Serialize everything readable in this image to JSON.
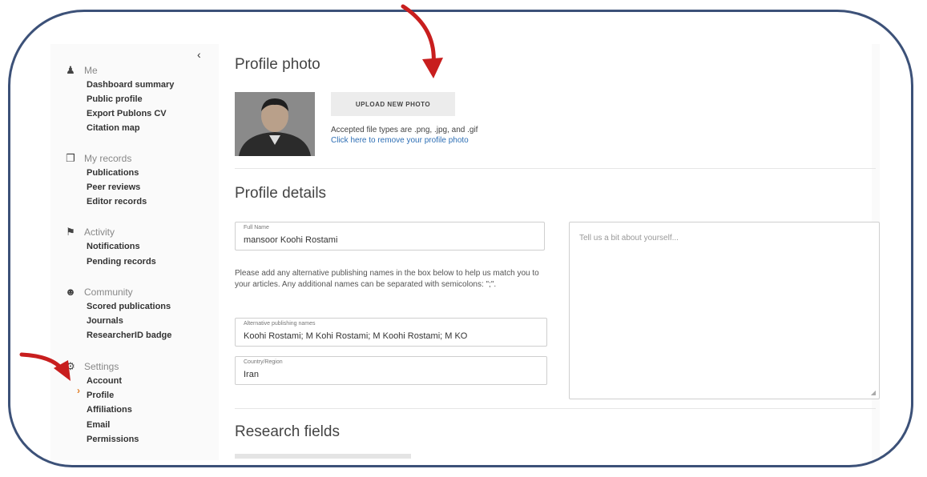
{
  "sidebar": {
    "collapse_icon": "chevron-left-icon",
    "sections": [
      {
        "title": "Me",
        "icon": "person-icon",
        "items": [
          "Dashboard summary",
          "Public profile",
          "Export Publons CV",
          "Citation map"
        ]
      },
      {
        "title": "My records",
        "icon": "copy-icon",
        "items": [
          "Publications",
          "Peer reviews",
          "Editor records"
        ]
      },
      {
        "title": "Activity",
        "icon": "flag-icon",
        "items": [
          "Notifications",
          "Pending records"
        ]
      },
      {
        "title": "Community",
        "icon": "people-icon",
        "items": [
          "Scored publications",
          "Journals",
          "ResearcherID badge"
        ]
      },
      {
        "title": "Settings",
        "icon": "gear-icon",
        "items": [
          "Account",
          "Profile",
          "Affiliations",
          "Email",
          "Permissions"
        ]
      }
    ],
    "active_item": "Profile"
  },
  "profile_photo": {
    "heading": "Profile photo",
    "upload_label": "UPLOAD NEW PHOTO",
    "accepted_text": "Accepted file types are .png, .jpg, and .gif",
    "remove_link": "Click here to remove your profile photo"
  },
  "profile_details": {
    "heading": "Profile details",
    "full_name": {
      "label": "Full Name",
      "value": "mansoor Koohi Rostami"
    },
    "help_text": "Please add any alternative publishing names in the box below to help us match you to your articles. Any additional names can be separated with semicolons: \";\".",
    "alt_names": {
      "label": "Alternative publishing names",
      "value": "Koohi Rostami; M Kohi Rostami; M Koohi Rostami; M KO"
    },
    "country": {
      "label": "Country/Region",
      "value": "Iran"
    },
    "bio_placeholder": "Tell us a bit about yourself..."
  },
  "research_fields": {
    "heading": "Research fields"
  },
  "colors": {
    "frame": "#3c5178",
    "arrow": "#c81e1e",
    "link": "#2e6fb5",
    "active_caret": "#e07b22"
  }
}
